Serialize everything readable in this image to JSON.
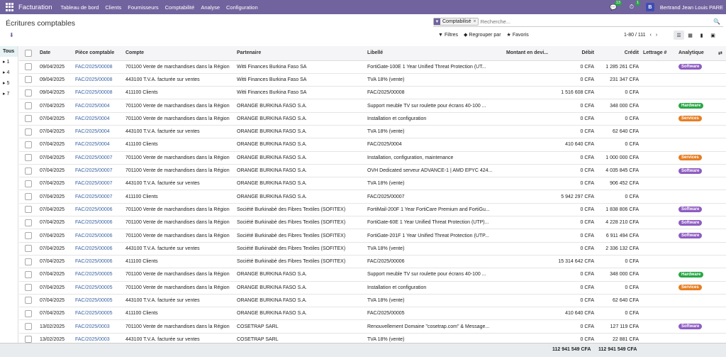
{
  "navbar": {
    "app_name": "Facturation",
    "menu": [
      "Tableau de bord",
      "Clients",
      "Fournisseurs",
      "Comptabilité",
      "Analyse",
      "Configuration"
    ],
    "messages_count": "13",
    "activities_count": "1",
    "user_initial": "B",
    "user_name": "Bertrand Jean Louis PARE"
  },
  "page": {
    "title": "Écritures comptables"
  },
  "search": {
    "facet_label": "Comptabilisé",
    "placeholder": "Recherche..."
  },
  "toolbar": {
    "filters": "Filtres",
    "group_by": "Regrouper par",
    "favorites": "Favoris"
  },
  "pager": {
    "value": "1-80 / 111"
  },
  "sidebar": {
    "items": [
      "Tous",
      "1",
      "4",
      "5",
      "7"
    ]
  },
  "table": {
    "columns": [
      "Date",
      "Pièce comptable",
      "Compte",
      "Partenaire",
      "Libellé",
      "Montant en devi...",
      "Débit",
      "Crédit",
      "Lettrage #",
      "Analytique"
    ],
    "rows": [
      {
        "date": "09/04/2025",
        "piece": "FAC/2025/00008",
        "compte": "701100 Vente de marchandises dans la Région",
        "partenaire": "Witti Finances Burkina Faso SA",
        "libelle": "FortiGate-100E 1 Year Unified Threat Protection (UT...",
        "debit": "0 CFA",
        "credit": "1 285 261 CFA",
        "tag": "Software"
      },
      {
        "date": "09/04/2025",
        "piece": "FAC/2025/00008",
        "compte": "443100 T.V.A. facturée sur ventes",
        "partenaire": "Witti Finances Burkina Faso SA",
        "libelle": "TVA 18% (vente)",
        "debit": "0 CFA",
        "credit": "231 347 CFA",
        "tag": ""
      },
      {
        "date": "09/04/2025",
        "piece": "FAC/2025/00008",
        "compte": "411100 Clients",
        "partenaire": "Witti Finances Burkina Faso SA",
        "libelle": "FAC/2025/00008",
        "debit": "1 516 608 CFA",
        "credit": "0 CFA",
        "tag": ""
      },
      {
        "date": "07/04/2025",
        "piece": "FAC/2025/0004",
        "compte": "701100 Vente de marchandises dans la Région",
        "partenaire": "ORANGE BURKINA FASO S.A.",
        "libelle": "Support meuble TV sur roulette pour écrans 40-100 ...",
        "debit": "0 CFA",
        "credit": "348 000 CFA",
        "tag": "Hardware"
      },
      {
        "date": "07/04/2025",
        "piece": "FAC/2025/0004",
        "compte": "701100 Vente de marchandises dans la Région",
        "partenaire": "ORANGE BURKINA FASO S.A.",
        "libelle": "Installation et configuration",
        "debit": "0 CFA",
        "credit": "0 CFA",
        "tag": "Services"
      },
      {
        "date": "07/04/2025",
        "piece": "FAC/2025/0004",
        "compte": "443100 T.V.A. facturée sur ventes",
        "partenaire": "ORANGE BURKINA FASO S.A.",
        "libelle": "TVA 18% (vente)",
        "debit": "0 CFA",
        "credit": "62 640 CFA",
        "tag": ""
      },
      {
        "date": "07/04/2025",
        "piece": "FAC/2025/0004",
        "compte": "411100 Clients",
        "partenaire": "ORANGE BURKINA FASO S.A.",
        "libelle": "FAC/2025/0004",
        "debit": "410 640 CFA",
        "credit": "0 CFA",
        "tag": ""
      },
      {
        "date": "07/04/2025",
        "piece": "FAC/2025/00007",
        "compte": "701100 Vente de marchandises dans la Région",
        "partenaire": "ORANGE BURKINA FASO S.A.",
        "libelle": "Installation, configuration, maintenance",
        "debit": "0 CFA",
        "credit": "1 000 000 CFA",
        "tag": "Services"
      },
      {
        "date": "07/04/2025",
        "piece": "FAC/2025/00007",
        "compte": "701100 Vente de marchandises dans la Région",
        "partenaire": "ORANGE BURKINA FASO S.A.",
        "libelle": "OVH Dedicated serveur ADVANCE-1 | AMD EPYC 424...",
        "debit": "0 CFA",
        "credit": "4 035 845 CFA",
        "tag": "Software"
      },
      {
        "date": "07/04/2025",
        "piece": "FAC/2025/00007",
        "compte": "443100 T.V.A. facturée sur ventes",
        "partenaire": "ORANGE BURKINA FASO S.A.",
        "libelle": "TVA 18% (vente)",
        "debit": "0 CFA",
        "credit": "906 452 CFA",
        "tag": ""
      },
      {
        "date": "07/04/2025",
        "piece": "FAC/2025/00007",
        "compte": "411100 Clients",
        "partenaire": "ORANGE BURKINA FASO S.A.",
        "libelle": "FAC/2025/00007",
        "debit": "5 942 297 CFA",
        "credit": "0 CFA",
        "tag": ""
      },
      {
        "date": "07/04/2025",
        "piece": "FAC/2025/00006",
        "compte": "701100 Vente de marchandises dans la Région",
        "partenaire": "Société Burkinabè des Fibres Textiles (SOFITEX)",
        "libelle": "FortiMail-200F 1 Year FortiCare Premium and FortiGu...",
        "debit": "0 CFA",
        "credit": "1 838 806 CFA",
        "tag": "Software"
      },
      {
        "date": "07/04/2025",
        "piece": "FAC/2025/00006",
        "compte": "701100 Vente de marchandises dans la Région",
        "partenaire": "Société Burkinabè des Fibres Textiles (SOFITEX)",
        "libelle": "FortiGate-60E 1 Year Unified Threat Protection (UTP)...",
        "debit": "0 CFA",
        "credit": "4 228 210 CFA",
        "tag": "Software"
      },
      {
        "date": "07/04/2025",
        "piece": "FAC/2025/00006",
        "compte": "701100 Vente de marchandises dans la Région",
        "partenaire": "Société Burkinabè des Fibres Textiles (SOFITEX)",
        "libelle": "FortiGate-201F 1 Year Unified Threat Protection (UTP...",
        "debit": "0 CFA",
        "credit": "6 911 494 CFA",
        "tag": "Software"
      },
      {
        "date": "07/04/2025",
        "piece": "FAC/2025/00006",
        "compte": "443100 T.V.A. facturée sur ventes",
        "partenaire": "Société Burkinabè des Fibres Textiles (SOFITEX)",
        "libelle": "TVA 18% (vente)",
        "debit": "0 CFA",
        "credit": "2 336 132 CFA",
        "tag": ""
      },
      {
        "date": "07/04/2025",
        "piece": "FAC/2025/00006",
        "compte": "411100 Clients",
        "partenaire": "Société Burkinabè des Fibres Textiles (SOFITEX)",
        "libelle": "FAC/2025/00006",
        "debit": "15 314 642 CFA",
        "credit": "0 CFA",
        "tag": ""
      },
      {
        "date": "07/04/2025",
        "piece": "FAC/2025/00005",
        "compte": "701100 Vente de marchandises dans la Région",
        "partenaire": "ORANGE BURKINA FASO S.A.",
        "libelle": "Support meuble TV sur roulette pour écrans 40-100 ...",
        "debit": "0 CFA",
        "credit": "348 000 CFA",
        "tag": "Hardware"
      },
      {
        "date": "07/04/2025",
        "piece": "FAC/2025/00005",
        "compte": "701100 Vente de marchandises dans la Région",
        "partenaire": "ORANGE BURKINA FASO S.A.",
        "libelle": "Installation et configuration",
        "debit": "0 CFA",
        "credit": "0 CFA",
        "tag": "Services"
      },
      {
        "date": "07/04/2025",
        "piece": "FAC/2025/00005",
        "compte": "443100 T.V.A. facturée sur ventes",
        "partenaire": "ORANGE BURKINA FASO S.A.",
        "libelle": "TVA 18% (vente)",
        "debit": "0 CFA",
        "credit": "62 640 CFA",
        "tag": ""
      },
      {
        "date": "07/04/2025",
        "piece": "FAC/2025/00005",
        "compte": "411100 Clients",
        "partenaire": "ORANGE BURKINA FASO S.A.",
        "libelle": "FAC/2025/00005",
        "debit": "410 640 CFA",
        "credit": "0 CFA",
        "tag": ""
      },
      {
        "date": "13/02/2025",
        "piece": "FAC/2025/0003",
        "compte": "701100 Vente de marchandises dans la Région",
        "partenaire": "COSETRAP SARL",
        "libelle": "Renouvellement Domaine \"cosetrap.com\" & Message...",
        "debit": "0 CFA",
        "credit": "127 119 CFA",
        "tag": "Software"
      },
      {
        "date": "13/02/2025",
        "piece": "FAC/2025/0003",
        "compte": "443100 T.V.A. facturée sur ventes",
        "partenaire": "COSETRAP SARL",
        "libelle": "TVA 18% (vente)",
        "debit": "0 CFA",
        "credit": "22 881 CFA",
        "tag": ""
      }
    ]
  },
  "footer": {
    "total_debit": "112 941 549 CFA",
    "total_credit": "112 941 549 CFA"
  },
  "colors": {
    "navbar": "#71639e",
    "software_tag": "#8e5cc2",
    "hardware_tag": "#28a745",
    "services_tag": "#e67e22"
  }
}
